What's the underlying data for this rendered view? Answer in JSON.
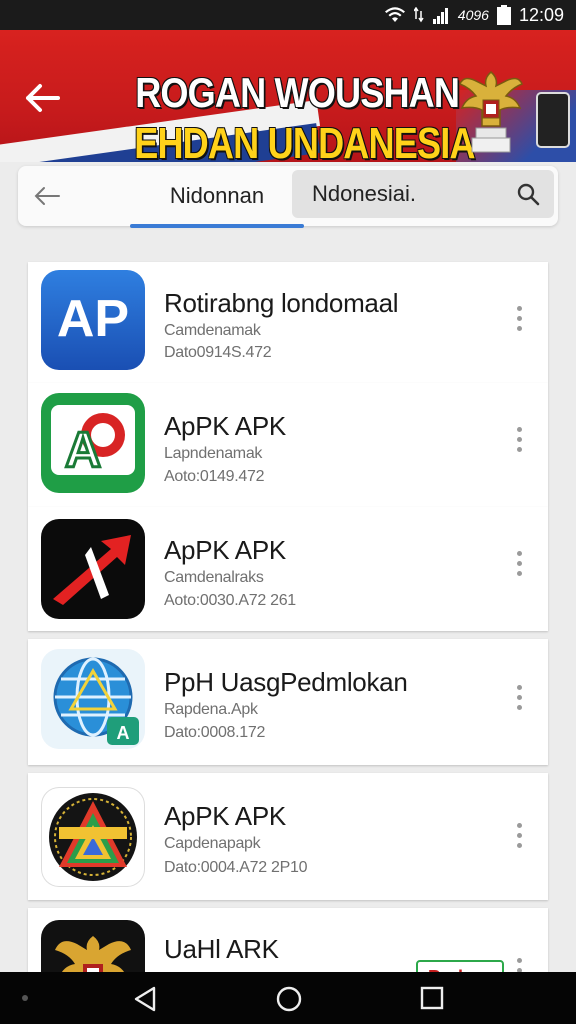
{
  "status_bar": {
    "time": "12:09",
    "signal_text": "4096"
  },
  "banner": {
    "title_line1": "ROGAN WOUSHAN",
    "title_line2": "EHDAN UNDANESIA"
  },
  "toolbar": {
    "tab_label": "Nidonnan",
    "search_value": "Ndonesiai."
  },
  "apps": [
    {
      "title": "Rotirabng londomaal",
      "line1": "Camdenamak",
      "line2": "Dato0914S.472",
      "icon": "ap-blue-icon"
    },
    {
      "title": "ApPK APK",
      "line1": "Lapndenamak",
      "line2": "Aoto:0149.472",
      "icon": "ap-green-icon"
    },
    {
      "title": "ApPK APK",
      "line1": "Camdenalraks",
      "line2": "Aoto:0030.A72   261",
      "icon": "red-arrow-icon"
    },
    {
      "title": "PpH UasgPedmlokan",
      "line1": "Rapdena.Apk",
      "line2": "Dato:0008.172",
      "icon": "globe-icon"
    },
    {
      "title": "ApPK APK",
      "line1": "Capdenapapk",
      "line2": "Dato:0004.A72   2P10",
      "icon": "rainbow-triangle-icon"
    },
    {
      "title": "UaHl ARK",
      "line1": "",
      "line2": "",
      "icon": "garuda-app-icon",
      "badge": "Budnor"
    }
  ],
  "colors": {
    "banner_red": "#d8221f",
    "banner_yellow": "#ffd21a",
    "accent_blue": "#3a7bd5",
    "card_bg": "#ffffff",
    "page_bg": "#ececec"
  }
}
